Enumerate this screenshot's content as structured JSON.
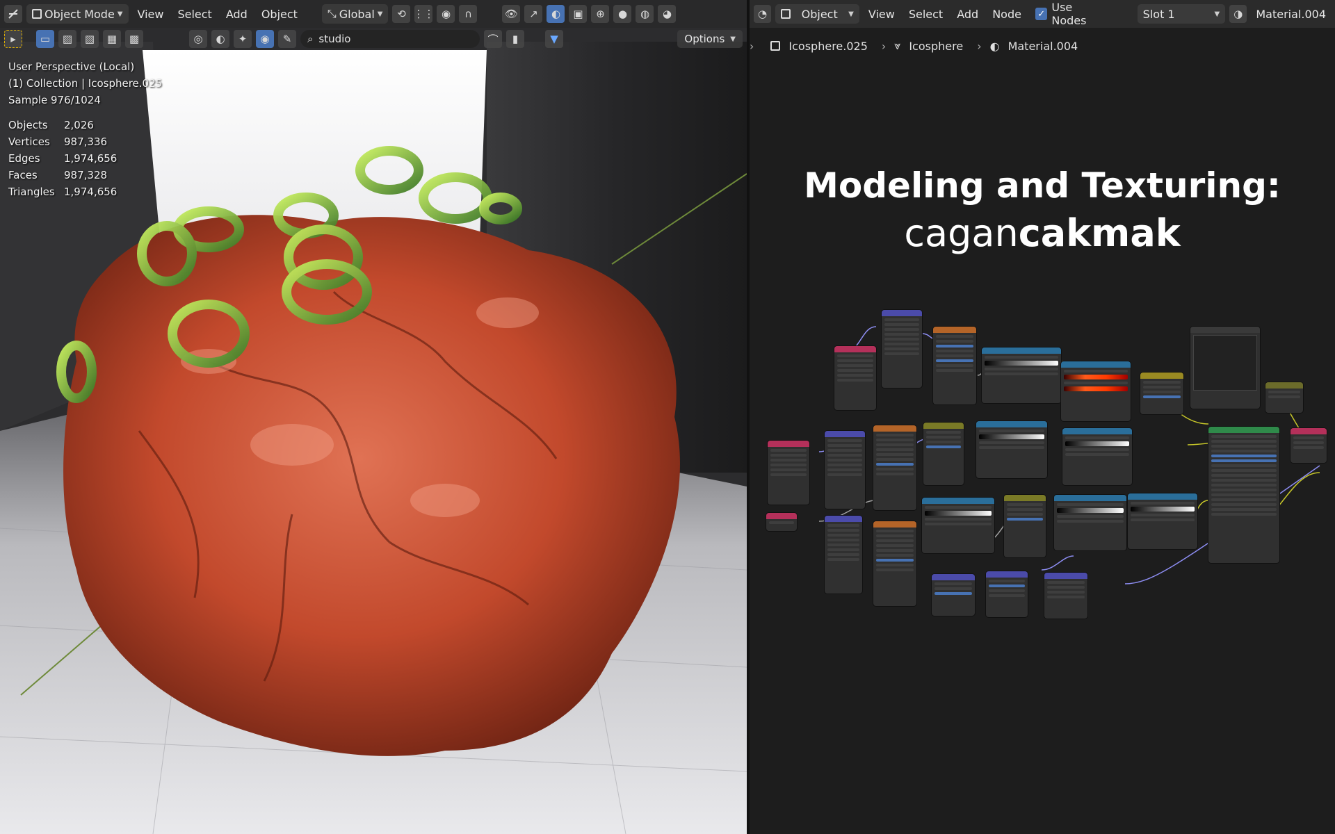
{
  "viewport": {
    "header": {
      "mode_label": "Object Mode",
      "menus": [
        "View",
        "Select",
        "Add",
        "Object"
      ],
      "orientation_label": "Global"
    },
    "header2": {
      "search_value": "studio",
      "options_label": "Options"
    },
    "info": {
      "perspective": "User Perspective (Local)",
      "collection": "(1) Collection | Icosphere.025",
      "sample": "Sample 976/1024"
    },
    "stats": [
      {
        "key": "Objects",
        "value": "2,026"
      },
      {
        "key": "Vertices",
        "value": "987,336"
      },
      {
        "key": "Edges",
        "value": "1,974,656"
      },
      {
        "key": "Faces",
        "value": "987,328"
      },
      {
        "key": "Triangles",
        "value": "1,974,656"
      }
    ]
  },
  "node_editor": {
    "header": {
      "object_label": "Object",
      "menus": [
        "View",
        "Select",
        "Add",
        "Node"
      ],
      "use_nodes_label": "Use Nodes",
      "slot_label": "Slot 1",
      "material_label": "Material.004"
    },
    "breadcrumb": [
      "Icosphere.025",
      "Icosphere",
      "Material.004"
    ],
    "title_line1": "Modeling and Texturing:",
    "title_line2_light": "cagan",
    "title_line2_bold": "cakmak"
  }
}
